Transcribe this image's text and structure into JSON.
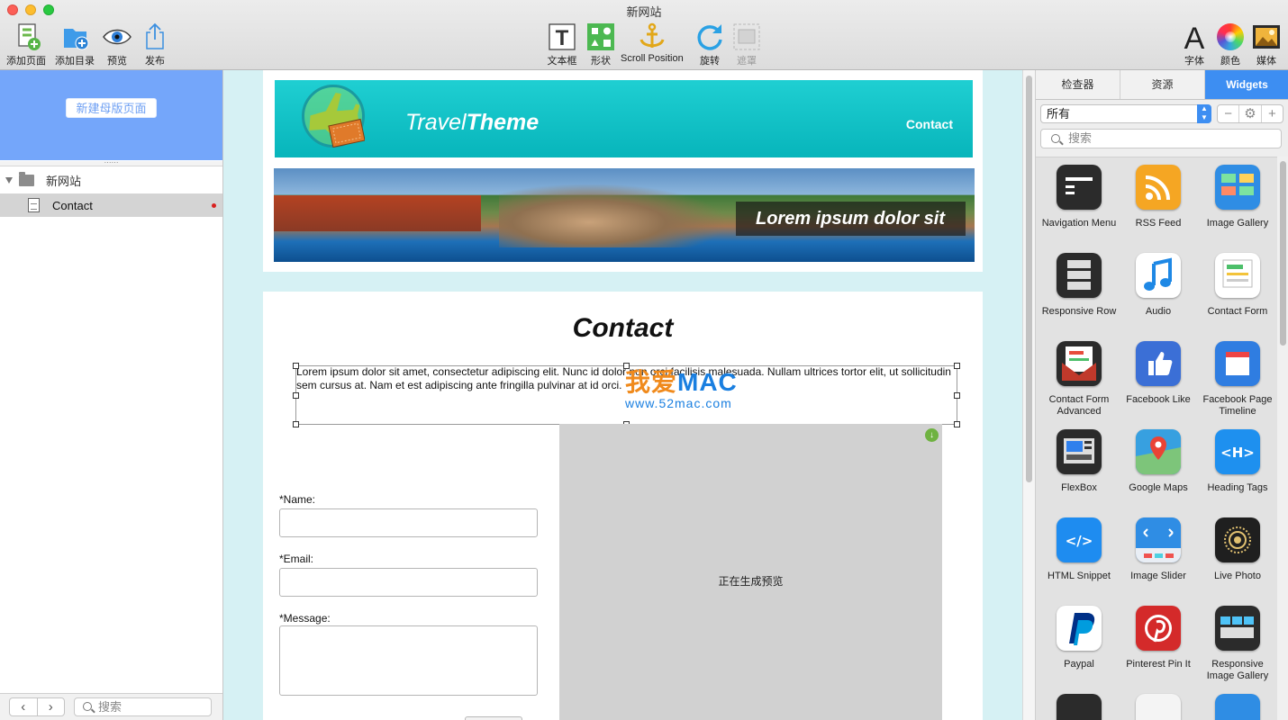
{
  "window": {
    "title": "新网站"
  },
  "toolbar": {
    "left": [
      {
        "label": "添加页面",
        "icon": "add-page-icon"
      },
      {
        "label": "添加目录",
        "icon": "add-folder-icon"
      },
      {
        "label": "预览",
        "icon": "eye-icon"
      },
      {
        "label": "发布",
        "icon": "share-icon"
      }
    ],
    "center": [
      {
        "label": "文本框",
        "icon": "text-box-icon"
      },
      {
        "label": "形状",
        "icon": "shapes-icon"
      },
      {
        "label": "Scroll Position",
        "icon": "anchor-icon"
      },
      {
        "label": "旋转",
        "icon": "rotate-icon"
      },
      {
        "label": "遮罩",
        "icon": "mask-icon",
        "disabled": true
      }
    ],
    "right": [
      {
        "label": "字体",
        "icon": "font-icon"
      },
      {
        "label": "颜色",
        "icon": "color-wheel-icon"
      },
      {
        "label": "媒体",
        "icon": "media-icon"
      }
    ]
  },
  "sidebar": {
    "master_button": "新建母版页面",
    "grip": "⋯⋯",
    "site": "新网站",
    "pages": [
      {
        "label": "Contact",
        "modified": true
      }
    ],
    "nav_back": "‹",
    "nav_forward": "›",
    "search_placeholder": "搜索"
  },
  "canvas": {
    "brand_light": "Travel",
    "brand_bold": "Theme",
    "header_link": "Contact",
    "hero_caption": "Lorem ipsum dolor sit",
    "heading": "Contact",
    "paragraph": "Lorem ipsum dolor sit amet, consectetur adipiscing elit. Nunc id dolor non orci facilisis malesuada. Nullam ultrices tortor elit, ut sollicitudin sem cursus at. Nam et est adipiscing ante fringilla pulvinar at id orci.",
    "form": {
      "name_label": "*Name:",
      "email_label": "*Email:",
      "message_label": "*Message:"
    },
    "preview_text": "正在生成预览",
    "watermark_main_a": "我爱",
    "watermark_main_b": "MAC",
    "watermark_url": "www.52mac.com"
  },
  "right_panel": {
    "tabs": [
      {
        "label": "检查器",
        "active": false
      },
      {
        "label": "资源",
        "active": false
      },
      {
        "label": "Widgets",
        "active": true
      }
    ],
    "filter": "所有",
    "seg_minus": "−",
    "seg_gear": "⚙",
    "seg_plus": "+",
    "search_placeholder": "搜索",
    "widgets": [
      {
        "label": "Navigation Menu",
        "icon": "navigation-menu-icon",
        "color": "#2b2b2b"
      },
      {
        "label": "RSS Feed",
        "icon": "rss-icon",
        "color": "#f5a623"
      },
      {
        "label": "Image Gallery",
        "icon": "image-gallery-icon",
        "color": "#2f8de4"
      },
      {
        "label": "Responsive Row",
        "icon": "responsive-row-icon",
        "color": "#2b2b2b"
      },
      {
        "label": "Audio",
        "icon": "audio-icon",
        "color": "#ffffff"
      },
      {
        "label": "Contact Form",
        "icon": "contact-form-icon",
        "color": "#ffffff"
      },
      {
        "label": "Contact Form Advanced",
        "icon": "contact-form-advanced-icon",
        "color": "#2b2b2b"
      },
      {
        "label": "Facebook Like",
        "icon": "facebook-like-icon",
        "color": "#3b6fd6"
      },
      {
        "label": "Facebook Page Timeline",
        "icon": "facebook-page-icon",
        "color": "#2f7de1"
      },
      {
        "label": "FlexBox",
        "icon": "flexbox-icon",
        "color": "#2b2b2b"
      },
      {
        "label": "Google Maps",
        "icon": "google-maps-icon",
        "color": "#37a0e0"
      },
      {
        "label": "Heading Tags",
        "icon": "heading-tags-icon",
        "color": "#1e90ef"
      },
      {
        "label": "HTML Snippet",
        "icon": "html-snippet-icon",
        "color": "#1e8cf0"
      },
      {
        "label": "Image Slider",
        "icon": "image-slider-icon",
        "color": "#2f8de4"
      },
      {
        "label": "Live Photo",
        "icon": "live-photo-icon",
        "color": "#1f1f1f"
      },
      {
        "label": "Paypal",
        "icon": "paypal-icon",
        "color": "#ffffff"
      },
      {
        "label": "Pinterest Pin It",
        "icon": "pinterest-icon",
        "color": "#d42a2a"
      },
      {
        "label": "Responsive Image Gallery",
        "icon": "responsive-image-gallery-icon",
        "color": "#2b2b2b"
      }
    ]
  },
  "colors": {
    "accent": "#3d8ef2",
    "master_area": "#74a6fa",
    "header_teal": "#07b5bb",
    "canvas_bg": "#d6f1f4"
  }
}
